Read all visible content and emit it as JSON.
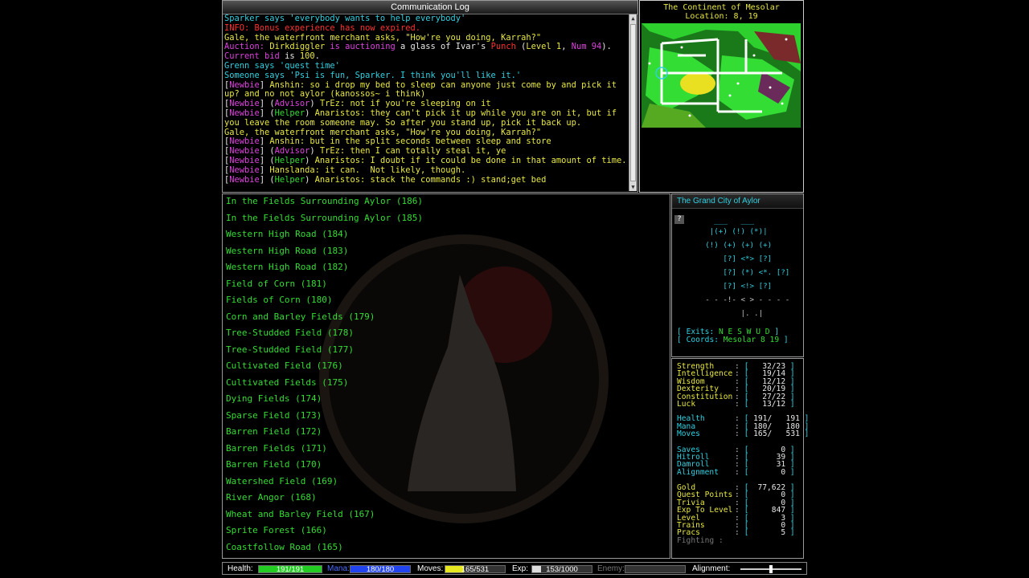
{
  "comm_log": {
    "title": "Communication Log",
    "lines": [
      [
        {
          "t": "Sparker says 'everybody wants to help everybody'",
          "c": "cyan"
        }
      ],
      [
        {
          "t": "INFO: Bonus experience has now expired.",
          "c": "red"
        }
      ],
      [
        {
          "t": "Gale, the waterfront merchant asks, \"How're you doing, Karrah?\"",
          "c": "yellow"
        }
      ],
      [
        {
          "t": "Auction: ",
          "c": "magenta"
        },
        {
          "t": "Dirkdiggler",
          "c": "yellow"
        },
        {
          "t": " is auctioning ",
          "c": "magenta"
        },
        {
          "t": "a glass of Ivar's ",
          "c": "white"
        },
        {
          "t": "Punch",
          "c": "red"
        },
        {
          "t": " (",
          "c": "white"
        },
        {
          "t": "Level 1",
          "c": "yellow"
        },
        {
          "t": ", ",
          "c": "white"
        },
        {
          "t": "Num 94",
          "c": "magenta"
        },
        {
          "t": ").",
          "c": "white"
        }
      ],
      [
        {
          "t": "Current bid",
          "c": "magenta"
        },
        {
          "t": " is ",
          "c": "white"
        },
        {
          "t": "100",
          "c": "yellow"
        },
        {
          "t": ".",
          "c": "white"
        }
      ],
      [
        {
          "t": "Grenn says 'quest time'",
          "c": "cyan"
        }
      ],
      [
        {
          "t": "Someone says 'Psi is fun, Sparker. I think you'll like it.'",
          "c": "cyan"
        }
      ],
      [
        {
          "t": "[",
          "c": "white"
        },
        {
          "t": "Newbie",
          "c": "magenta"
        },
        {
          "t": "] ",
          "c": "white"
        },
        {
          "t": "Anshin: so i drop my bed to sleep can anyone just come by and pick it up? and no not aylor (kanossos~ i think)",
          "c": "yellow"
        }
      ],
      [
        {
          "t": "[",
          "c": "white"
        },
        {
          "t": "Newbie",
          "c": "magenta"
        },
        {
          "t": "] (",
          "c": "white"
        },
        {
          "t": "Advisor",
          "c": "magenta"
        },
        {
          "t": ") ",
          "c": "white"
        },
        {
          "t": "TrEz: not if you're sleeping on it",
          "c": "yellow"
        }
      ],
      [
        {
          "t": "[",
          "c": "white"
        },
        {
          "t": "Newbie",
          "c": "magenta"
        },
        {
          "t": "] (",
          "c": "white"
        },
        {
          "t": "Helper",
          "c": "green"
        },
        {
          "t": ") ",
          "c": "white"
        },
        {
          "t": "Anaristos: they can't pick it up while you are on it, but if you leave the room someone may. So after you stand up, pick it back up.",
          "c": "yellow"
        }
      ],
      [
        {
          "t": "Gale, the waterfront merchant asks, \"How're you doing, Karrah?\"",
          "c": "yellow"
        }
      ],
      [
        {
          "t": "[",
          "c": "white"
        },
        {
          "t": "Newbie",
          "c": "magenta"
        },
        {
          "t": "] ",
          "c": "white"
        },
        {
          "t": "Anshin: but in the split seconds between sleep and store",
          "c": "yellow"
        }
      ],
      [
        {
          "t": "[",
          "c": "white"
        },
        {
          "t": "Newbie",
          "c": "magenta"
        },
        {
          "t": "] (",
          "c": "white"
        },
        {
          "t": "Advisor",
          "c": "magenta"
        },
        {
          "t": ") ",
          "c": "white"
        },
        {
          "t": "TrEz: then I can totally steal it, ye",
          "c": "yellow"
        }
      ],
      [
        {
          "t": "[",
          "c": "white"
        },
        {
          "t": "Newbie",
          "c": "magenta"
        },
        {
          "t": "] (",
          "c": "white"
        },
        {
          "t": "Helper",
          "c": "green"
        },
        {
          "t": ") ",
          "c": "white"
        },
        {
          "t": "Anaristos: I doubt if it could be done in that amount of time.",
          "c": "yellow"
        }
      ],
      [
        {
          "t": "[",
          "c": "white"
        },
        {
          "t": "Newbie",
          "c": "magenta"
        },
        {
          "t": "] ",
          "c": "white"
        },
        {
          "t": "Hanslanda: it can.  Not likely, though.",
          "c": "yellow"
        }
      ],
      [
        {
          "t": "[",
          "c": "white"
        },
        {
          "t": "Newbie",
          "c": "magenta"
        },
        {
          "t": "] (",
          "c": "white"
        },
        {
          "t": "Helper",
          "c": "green"
        },
        {
          "t": ") ",
          "c": "white"
        },
        {
          "t": "Anaristos: stack the commands :) stand;get bed",
          "c": "yellow"
        }
      ]
    ]
  },
  "continent_map": {
    "title": "The Continent of Mesolar",
    "location": "Location:  8, 19"
  },
  "rooms": [
    "In the Fields Surrounding Aylor (186)",
    "In the Fields Surrounding Aylor (185)",
    "Western High Road (184)",
    "Western High Road (183)",
    "Western High Road (182)",
    "Field of Corn (181)",
    "Fields of Corn (180)",
    "Corn and Barley Fields (179)",
    "Tree-Studded Field (178)",
    "Tree-Studded Field (177)",
    "Cultivated Field (176)",
    "Cultivated Fields (175)",
    "Dying Fields (174)",
    "Sparse Field (173)",
    "Barren Field (172)",
    "Barren Fields (171)",
    "Barren Field (170)",
    "Watershed Field (169)",
    "River Angor (168)",
    "Wheat and Barley Field (167)",
    "Sprite Forest (166)",
    "Coastfollow Road (165)"
  ],
  "area_map": {
    "title": "The Grand City of Aylor",
    "help": "?",
    "grid": [
      "        ___   ___",
      "       |(+) (!) (*)|",
      "      (!) (+) (+) (+)",
      "          [?] <*> [?]",
      "          [?] (*) <*. [?]",
      "          [?] <!> [?]",
      "      - - -!- < > - - - -",
      "              |. .|"
    ],
    "exits_label": "Exits:",
    "exits": "N E S W U D",
    "coords_label": "Coords:",
    "coords": "Mesolar 8 19"
  },
  "stats": {
    "attributes": [
      {
        "label": "Strength",
        "value": "32/23"
      },
      {
        "label": "Intelligence",
        "value": "19/14"
      },
      {
        "label": "Wisdom",
        "value": "12/12"
      },
      {
        "label": "Dexterity",
        "value": "20/19"
      },
      {
        "label": "Constitution",
        "value": "27/22"
      },
      {
        "label": "Luck",
        "value": "13/12"
      }
    ],
    "vitals": [
      {
        "label": "Health",
        "value": "191/   191"
      },
      {
        "label": "Mana",
        "value": "180/   180"
      },
      {
        "label": "Moves",
        "value": "165/   531"
      }
    ],
    "combat": [
      {
        "label": "Saves",
        "value": "0"
      },
      {
        "label": "Hitroll",
        "value": "39"
      },
      {
        "label": "Damroll",
        "value": "31"
      },
      {
        "label": "Alignment",
        "value": "0"
      }
    ],
    "progress": [
      {
        "label": "Gold",
        "value": "77,622"
      },
      {
        "label": "Quest Points",
        "value": "0"
      },
      {
        "label": "Trivia",
        "value": "0"
      },
      {
        "label": "Exp To Level",
        "value": "847"
      },
      {
        "label": "Level",
        "value": "3"
      },
      {
        "label": "Trains",
        "value": "0"
      },
      {
        "label": "Pracs",
        "value": "5"
      }
    ],
    "fighting_label": "Fighting :"
  },
  "status_bar": {
    "health": {
      "label": "Health:",
      "text": "191/191",
      "fraction": 1.0,
      "color": "#22cc22"
    },
    "mana": {
      "label": "Mana:",
      "text": "180/180",
      "fraction": 1.0,
      "color": "#2244ee"
    },
    "moves": {
      "label": "Moves:",
      "text": "165/531",
      "fraction": 0.31,
      "color": "#e8e820"
    },
    "exp": {
      "label": "Exp:",
      "text": "153/1000",
      "fraction": 0.15,
      "color": "#dddddd"
    },
    "enemy": {
      "label": "Enemy:",
      "text": "",
      "fraction": 0,
      "color": "#666666"
    },
    "alignment": {
      "label": "Alignment:",
      "fraction": 0.5
    }
  }
}
